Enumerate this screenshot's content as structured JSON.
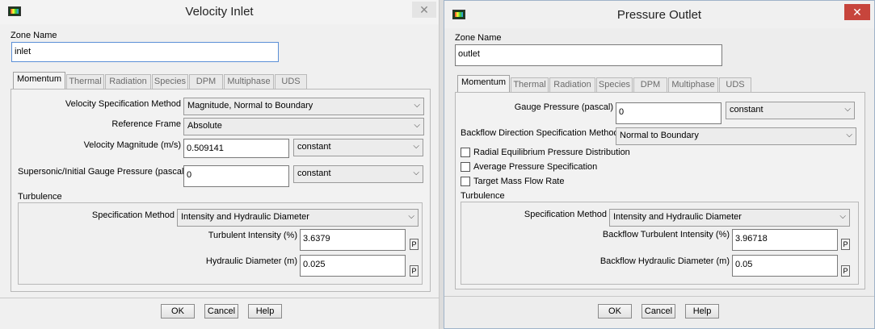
{
  "velocity_inlet": {
    "title": "Velocity Inlet",
    "close": "✕",
    "zone_name_label": "Zone Name",
    "zone_name_value": "inlet",
    "tabs": [
      "Momentum",
      "Thermal",
      "Radiation",
      "Species",
      "DPM",
      "Multiphase",
      "UDS"
    ],
    "velocity_spec_label": "Velocity Specification Method",
    "velocity_spec_value": "Magnitude, Normal to Boundary",
    "reference_frame_label": "Reference Frame",
    "reference_frame_value": "Absolute",
    "velocity_magnitude_label": "Velocity Magnitude (m/s)",
    "velocity_magnitude_value": "0.509141",
    "velocity_magnitude_profile": "constant",
    "gauge_pressure_label": "Supersonic/Initial Gauge Pressure (pascal)",
    "gauge_pressure_value": "0",
    "gauge_pressure_profile": "constant",
    "turbulence_label": "Turbulence",
    "spec_method_label": "Specification Method",
    "spec_method_value": "Intensity and Hydraulic Diameter",
    "turb_intensity_label": "Turbulent Intensity (%)",
    "turb_intensity_value": "3.6379",
    "hydraulic_diameter_label": "Hydraulic Diameter (m)",
    "hydraulic_diameter_value": "0.025",
    "p_label": "P",
    "ok": "OK",
    "cancel": "Cancel",
    "help": "Help"
  },
  "pressure_outlet": {
    "title": "Pressure Outlet",
    "close": "✕",
    "zone_name_label": "Zone Name",
    "zone_name_value": "outlet",
    "tabs": [
      "Momentum",
      "Thermal",
      "Radiation",
      "Species",
      "DPM",
      "Multiphase",
      "UDS"
    ],
    "gauge_pressure_label": "Gauge Pressure (pascal)",
    "gauge_pressure_value": "0",
    "gauge_pressure_profile": "constant",
    "backflow_dir_label": "Backflow Direction Specification Method",
    "backflow_dir_value": "Normal to Boundary",
    "radial_eq_label": "Radial Equilibrium Pressure Distribution",
    "avg_pressure_label": "Average Pressure Specification",
    "target_mass_label": "Target Mass Flow Rate",
    "turbulence_label": "Turbulence",
    "spec_method_label": "Specification Method",
    "spec_method_value": "Intensity and Hydraulic Diameter",
    "backflow_intensity_label": "Backflow Turbulent Intensity (%)",
    "backflow_intensity_value": "3.96718",
    "backflow_diameter_label": "Backflow Hydraulic Diameter (m)",
    "backflow_diameter_value": "0.05",
    "p_label": "P",
    "ok": "OK",
    "cancel": "Cancel",
    "help": "Help"
  },
  "icons": {
    "dropdown": "⌵"
  }
}
